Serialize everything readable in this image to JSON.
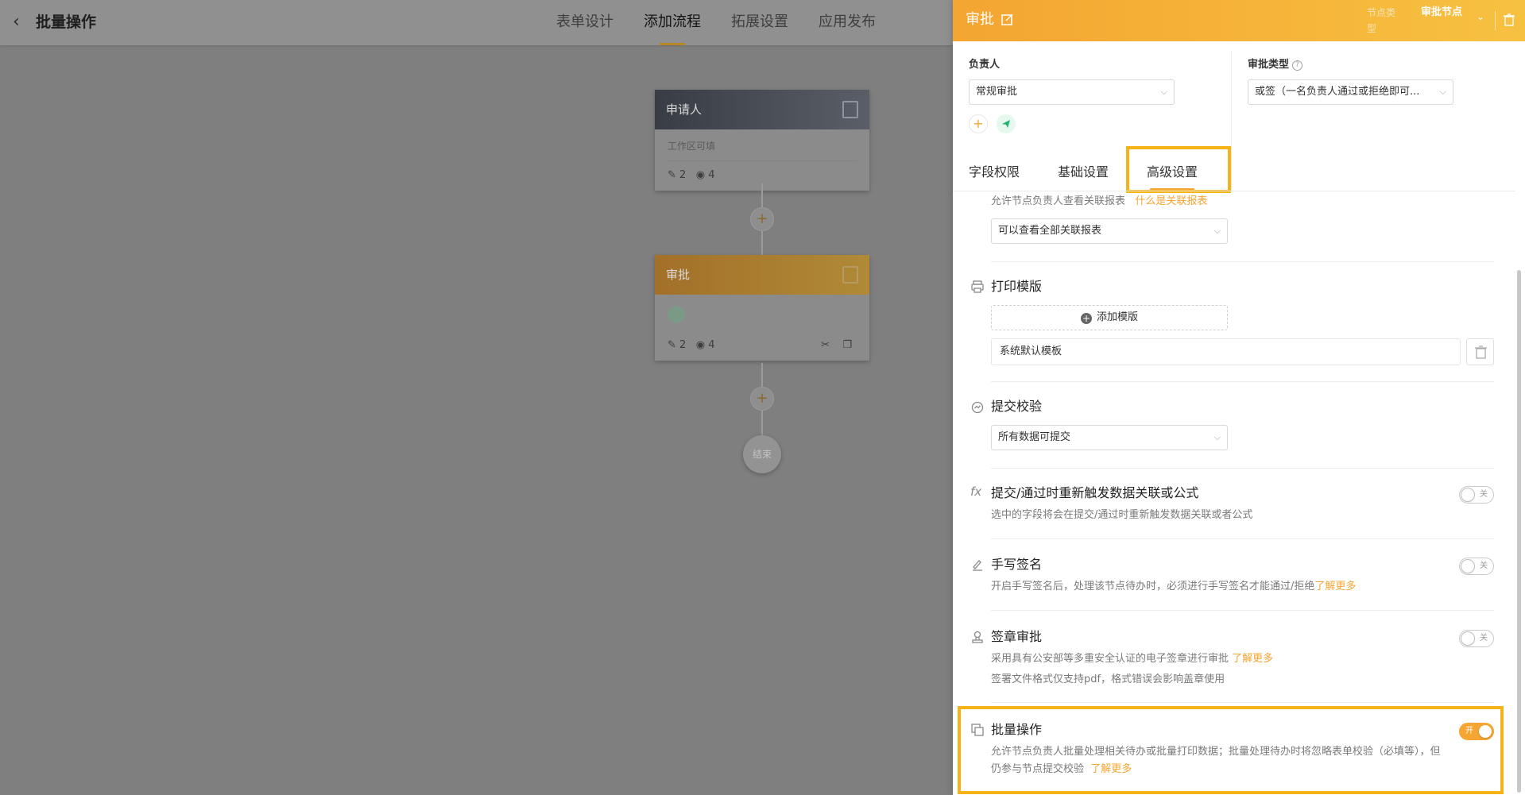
{
  "header": {
    "back_icon": "chevron-left-icon",
    "title": "批量操作",
    "tabs": [
      "表单设计",
      "添加流程",
      "拓展设置",
      "应用发布"
    ],
    "active_tab": "添加流程",
    "accent": "#f4a532"
  },
  "flow": {
    "applicant": {
      "title": "申请人",
      "subtitle": "工作区可填",
      "edit_count": "2",
      "view_count": "4"
    },
    "approval": {
      "title": "审批",
      "edit_count": "2",
      "view_count": "4"
    },
    "add_symbol": "+",
    "end_label": "结束"
  },
  "drawer": {
    "title": "审批",
    "node_type_label": "节点类型",
    "node_type_value": "审批节点",
    "owner_label": "负责人",
    "owner_value": "常规审批",
    "approval_type_label": "审批类型",
    "approval_type_help": "?",
    "approval_type_value": "或签（一名负责人通过或拒绝即可...",
    "add_symbol": "+",
    "tabs": [
      "字段权限",
      "基础设置",
      "高级设置"
    ],
    "active_tab": "高级设置",
    "related_report": {
      "desc": "允许节点负责人查看关联报表",
      "link": "什么是关联报表",
      "select": "可以查看全部关联报表"
    },
    "print": {
      "title": "打印模版",
      "add_label": "添加模版",
      "template_name": "系统默认模板"
    },
    "validation": {
      "title": "提交校验",
      "select": "所有数据可提交"
    },
    "retrigger": {
      "title": "提交/通过时重新触发数据关联或公式",
      "desc": "选中的字段将会在提交/通过时重新触发数据关联或者公式",
      "toggle": "关"
    },
    "handwrite": {
      "title": "手写签名",
      "desc": "开启手写签名后，处理该节点待办时，必须进行手写签名才能通过/拒绝",
      "link": "了解更多",
      "toggle": "关"
    },
    "seal": {
      "title": "签章审批",
      "desc": "采用具有公安部等多重安全认证的电子签章进行审批",
      "link": "了解更多",
      "desc2": "签署文件格式仅支持pdf，格式错误会影响盖章使用",
      "toggle": "关"
    },
    "batch": {
      "title": "批量操作",
      "desc1": "允许节点负责人批量处理相关待办或批量打印数据；批量处理待办时将忽略表单校验（必填等），但",
      "desc2": "仍参与节点提交校验",
      "link": "了解更多",
      "toggle": "开",
      "enabled": true
    },
    "highlight_color": "#f5b318"
  }
}
